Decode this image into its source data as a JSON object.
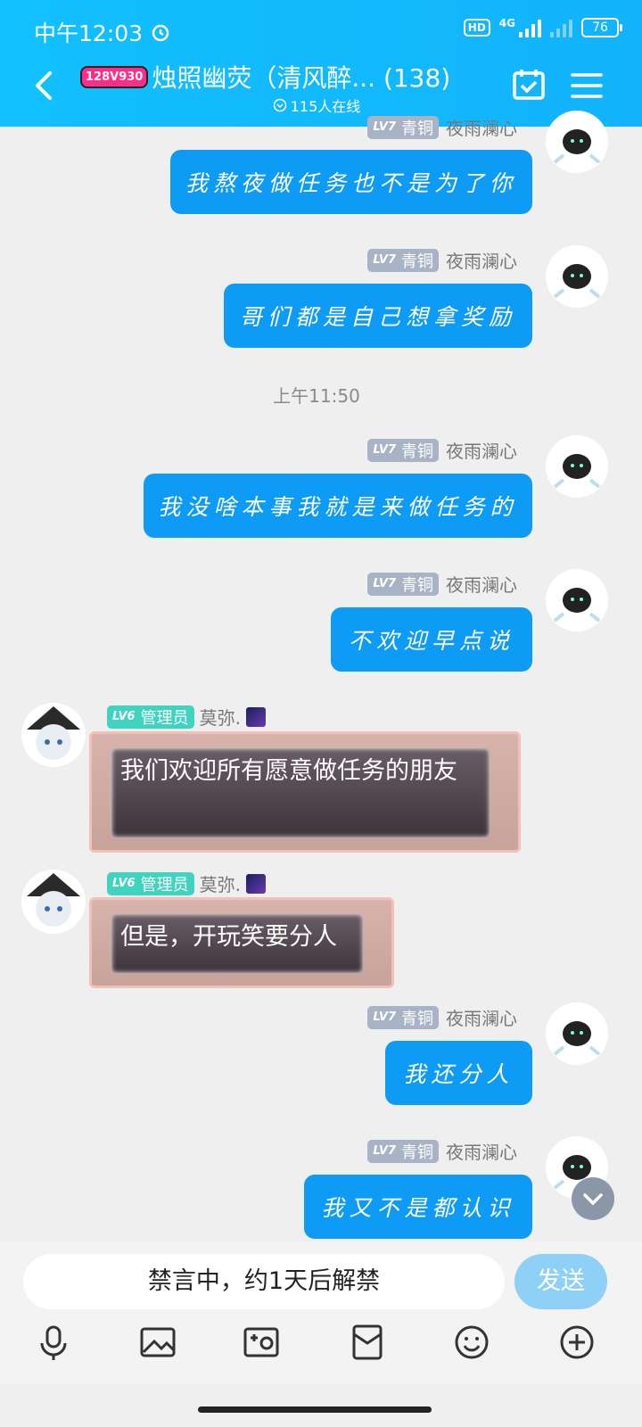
{
  "status": {
    "time": "中午12:03",
    "network": "4G",
    "hd": "HD",
    "battery": "76"
  },
  "header": {
    "logo": "128V930",
    "title": "烛照幽荧（清风醉... (138)",
    "online": "115人在线"
  },
  "messages": [
    {
      "level": "LV7",
      "rank": "青铜",
      "name": "夜雨澜心",
      "text": "我熬夜做任务也不是为了你"
    },
    {
      "level": "LV7",
      "rank": "青铜",
      "name": "夜雨澜心",
      "text": "哥们都是自己想拿奖励"
    },
    {
      "level": "LV7",
      "rank": "青铜",
      "name": "夜雨澜心",
      "text": "我没啥本事我就是来做任务的"
    },
    {
      "level": "LV7",
      "rank": "青铜",
      "name": "夜雨澜心",
      "text": "不欢迎早点说"
    },
    {
      "level": "LV7",
      "rank": "青铜",
      "name": "夜雨澜心",
      "text": "我还分人"
    },
    {
      "level": "LV7",
      "rank": "青铜",
      "name": "夜雨澜心",
      "text": "我又不是都认识"
    }
  ],
  "time_sep": "上午11:50",
  "admin_msgs": [
    {
      "level": "LV6",
      "rank": "管理员",
      "name": "莫弥.",
      "text": "我们欢迎所有愿意做任务的朋友"
    },
    {
      "level": "LV6",
      "rank": "管理员",
      "name": "莫弥.",
      "text": "但是，开玩笑要分人"
    }
  ],
  "input": {
    "text": "禁言中，约1天后解禁",
    "send": "发送"
  },
  "colors": {
    "header": "#12b8fd",
    "bubble": "#0d9bf5",
    "level": "#a9b3c6",
    "admin": "#3fd3c0"
  }
}
